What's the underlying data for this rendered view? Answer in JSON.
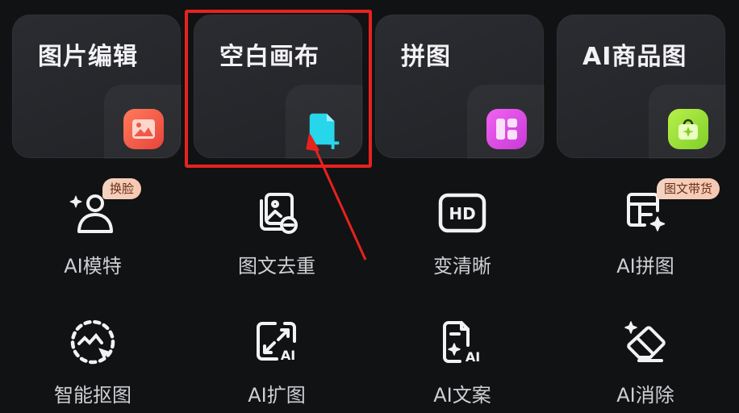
{
  "cards": [
    {
      "title": "图片编辑",
      "icon": "image-icon",
      "color": "#f0584a"
    },
    {
      "title": "空白画布",
      "icon": "new-file-icon",
      "color": "#22d3e8"
    },
    {
      "title": "拼图",
      "icon": "collage-icon",
      "color": "#e04fe6"
    },
    {
      "title": "AI商品图",
      "icon": "shopping-bag-icon",
      "color": "#a6e83a"
    }
  ],
  "tools": [
    {
      "label": "AI模特",
      "icon": "ai-model-icon",
      "badge": "换脸"
    },
    {
      "label": "图文去重",
      "icon": "dedupe-icon",
      "badge": ""
    },
    {
      "label": "变清晰",
      "icon": "hd-icon",
      "badge": ""
    },
    {
      "label": "AI拼图",
      "icon": "ai-collage-icon",
      "badge": "图文带货"
    },
    {
      "label": "智能抠图",
      "icon": "smart-cutout-icon",
      "badge": ""
    },
    {
      "label": "AI扩图",
      "icon": "ai-expand-icon",
      "badge": ""
    },
    {
      "label": "AI文案",
      "icon": "ai-copywriting-icon",
      "badge": ""
    },
    {
      "label": "AI消除",
      "icon": "ai-eraser-icon",
      "badge": ""
    }
  ],
  "colors": {
    "highlight": "#e7221f",
    "badge_bg": "#f6c7b0"
  }
}
